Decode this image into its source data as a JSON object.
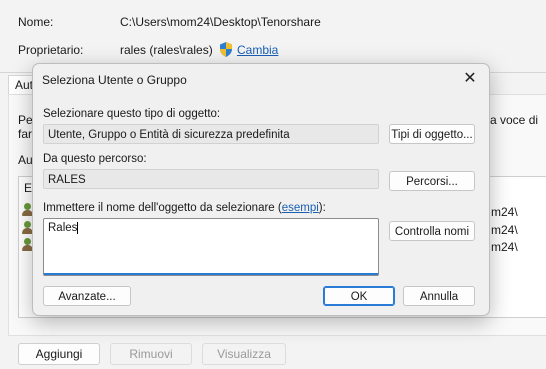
{
  "background": {
    "name_label": "Nome:",
    "name_value": "C:\\Users\\mom24\\Desktop\\Tenorshare",
    "owner_label": "Proprietario:",
    "owner_value": "rales (rales\\rales)",
    "change_link": "Cambia",
    "tab_label": "Aut",
    "side_text_left_1": "Pe",
    "side_text_left_2": "far",
    "side_text_right": "a voce di",
    "list_label_left": "Au",
    "list_header_left": "Er",
    "list_rows": [
      "m24\\",
      "m24\\",
      "m24\\"
    ],
    "buttons": {
      "add": "Aggiungi",
      "remove": "Rimuovi",
      "view": "Visualizza"
    }
  },
  "dialog": {
    "title": "Seleziona Utente o Gruppo",
    "close_glyph": "✕",
    "object_type_label": "Selezionare questo tipo di oggetto:",
    "object_type_value": "Utente, Gruppo o Entità di sicurezza predefinita",
    "object_types_button": "Tipi di oggetto...",
    "location_label": "Da questo percorso:",
    "location_value": "RALES",
    "locations_button": "Percorsi...",
    "enter_label_prefix": "Immettere il nome dell'oggetto da selezionare (",
    "enter_label_link": "esempi",
    "enter_label_suffix": "):",
    "object_names_value": "Rales",
    "check_names_button": "Controlla nomi",
    "advanced_button": "Avanzate...",
    "ok_button": "OK",
    "cancel_button": "Annulla"
  },
  "colors": {
    "accent": "#2a7bd6",
    "link": "#1a5fb4"
  },
  "icons": [
    "shield-icon",
    "close-icon",
    "user-group-icon"
  ]
}
